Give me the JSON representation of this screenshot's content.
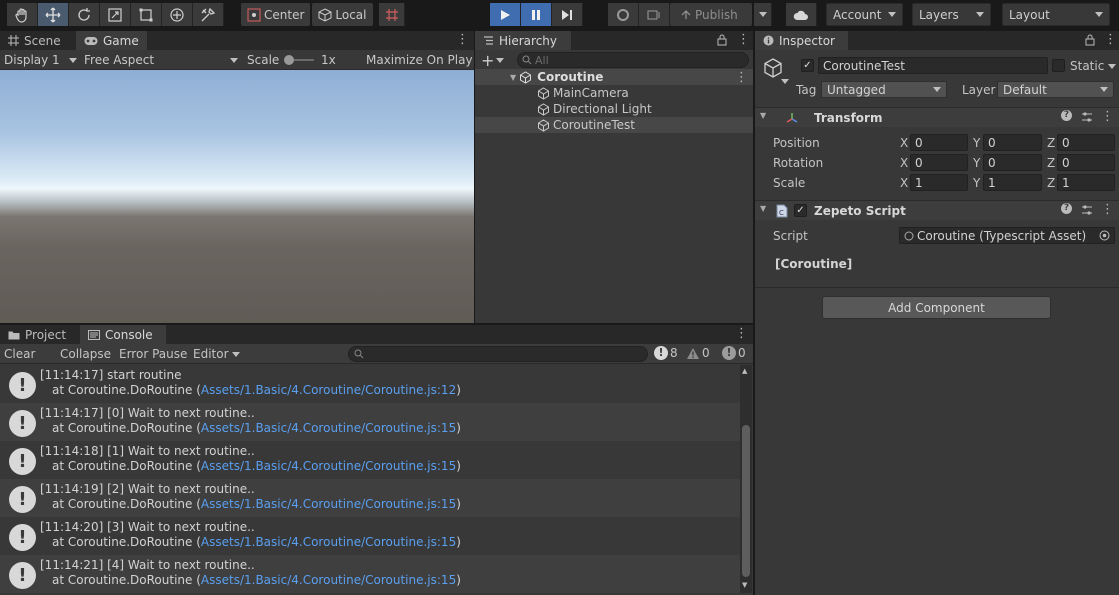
{
  "toolbar": {
    "pivot_label": "Center",
    "space_label": "Local",
    "publish_label": "Publish",
    "account_label": "Account",
    "layers_label": "Layers",
    "layout_label": "Layout"
  },
  "game_panel": {
    "tabs": [
      {
        "label": "Scene"
      },
      {
        "label": "Game"
      }
    ],
    "display_label": "Display 1",
    "aspect_label": "Free Aspect",
    "scale_label": "Scale",
    "scale_value": "1x",
    "maximize_label": "Maximize On Play"
  },
  "hierarchy": {
    "tab_label": "Hierarchy",
    "search_placeholder": "All",
    "scene_name": "Coroutine",
    "items": [
      {
        "label": "MainCamera"
      },
      {
        "label": "Directional Light"
      },
      {
        "label": "CoroutineTest"
      }
    ]
  },
  "inspector": {
    "tab_label": "Inspector",
    "object_name": "CoroutineTest",
    "static_label": "Static",
    "tag_label": "Tag",
    "tag_value": "Untagged",
    "layer_label": "Layer",
    "layer_value": "Default",
    "transform": {
      "title": "Transform",
      "position_label": "Position",
      "rotation_label": "Rotation",
      "scale_label": "Scale",
      "axis_x": "X",
      "axis_y": "Y",
      "axis_z": "Z",
      "position": [
        "0",
        "0",
        "0"
      ],
      "rotation": [
        "0",
        "0",
        "0"
      ],
      "scale": [
        "1",
        "1",
        "1"
      ]
    },
    "zepeto_script": {
      "title": "Zepeto Script",
      "script_label": "Script",
      "script_value": "Coroutine (Typescript Asset)",
      "section_label": "[Coroutine]"
    },
    "add_component_label": "Add Component"
  },
  "console_panel": {
    "tabs": [
      {
        "label": "Project"
      },
      {
        "label": "Console"
      }
    ],
    "clear_label": "Clear",
    "collapse_label": "Collapse",
    "error_pause_label": "Error Pause",
    "editor_label": "Editor",
    "log_count": "8",
    "warn_count": "0",
    "error_count": "0",
    "entries": [
      {
        "line1": "[11:14:17] start routine",
        "prefix": "at Coroutine.DoRoutine (",
        "link": "Assets/1.Basic/4.Coroutine/Coroutine.js:12",
        "suffix": ")"
      },
      {
        "line1": "[11:14:17] [0] Wait to next routine..",
        "prefix": "at Coroutine.DoRoutine (",
        "link": "Assets/1.Basic/4.Coroutine/Coroutine.js:15",
        "suffix": ")"
      },
      {
        "line1": "[11:14:18] [1] Wait to next routine..",
        "prefix": "at Coroutine.DoRoutine (",
        "link": "Assets/1.Basic/4.Coroutine/Coroutine.js:15",
        "suffix": ")"
      },
      {
        "line1": "[11:14:19] [2] Wait to next routine..",
        "prefix": "at Coroutine.DoRoutine (",
        "link": "Assets/1.Basic/4.Coroutine/Coroutine.js:15",
        "suffix": ")"
      },
      {
        "line1": "[11:14:20] [3] Wait to next routine..",
        "prefix": "at Coroutine.DoRoutine (",
        "link": "Assets/1.Basic/4.Coroutine/Coroutine.js:15",
        "suffix": ")"
      },
      {
        "line1": "[11:14:21] [4] Wait to next routine..",
        "prefix": "at Coroutine.DoRoutine (",
        "link": "Assets/1.Basic/4.Coroutine/Coroutine.js:15",
        "suffix": ")"
      }
    ]
  },
  "icons": {
    "tools": [
      "hand-icon",
      "move-icon",
      "rotate-icon",
      "scale-icon",
      "rect-icon",
      "transform-icon",
      "custom-tool-icon"
    ],
    "accent_play": "#3f6db0",
    "link_color": "#5a9ff0"
  }
}
